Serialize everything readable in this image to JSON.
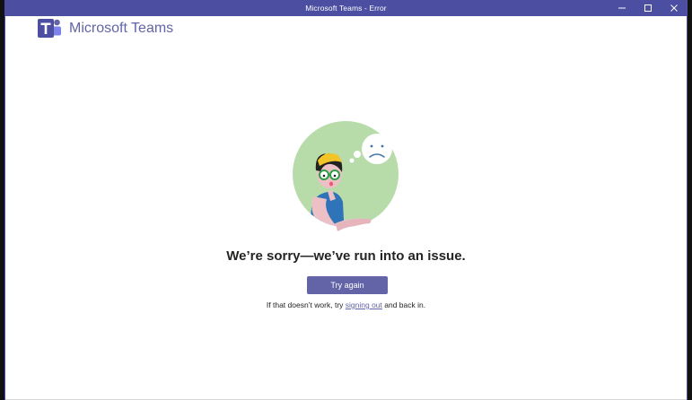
{
  "window": {
    "title": "Microsoft Teams - Error",
    "controls": [
      {
        "name": "minimize",
        "icon": "minimize-icon"
      },
      {
        "name": "maximize",
        "icon": "maximize-icon"
      },
      {
        "name": "close",
        "icon": "close-icon"
      }
    ]
  },
  "brand": {
    "name": "Microsoft Teams",
    "logo": "teams-logo",
    "color": "#6264a7"
  },
  "error": {
    "illustration": "sad-person-thought-bubble-illustration",
    "headline": "We’re sorry—we’ve run into an issue.",
    "retry_label": "Try again",
    "helper_prefix": "If that doesn’t work, try ",
    "helper_link": "signing out",
    "helper_suffix": " and back in."
  },
  "colors": {
    "titlebar": "#4b4ea1",
    "button": "#6264a7",
    "illustration_circle": "#b7dcaa"
  }
}
